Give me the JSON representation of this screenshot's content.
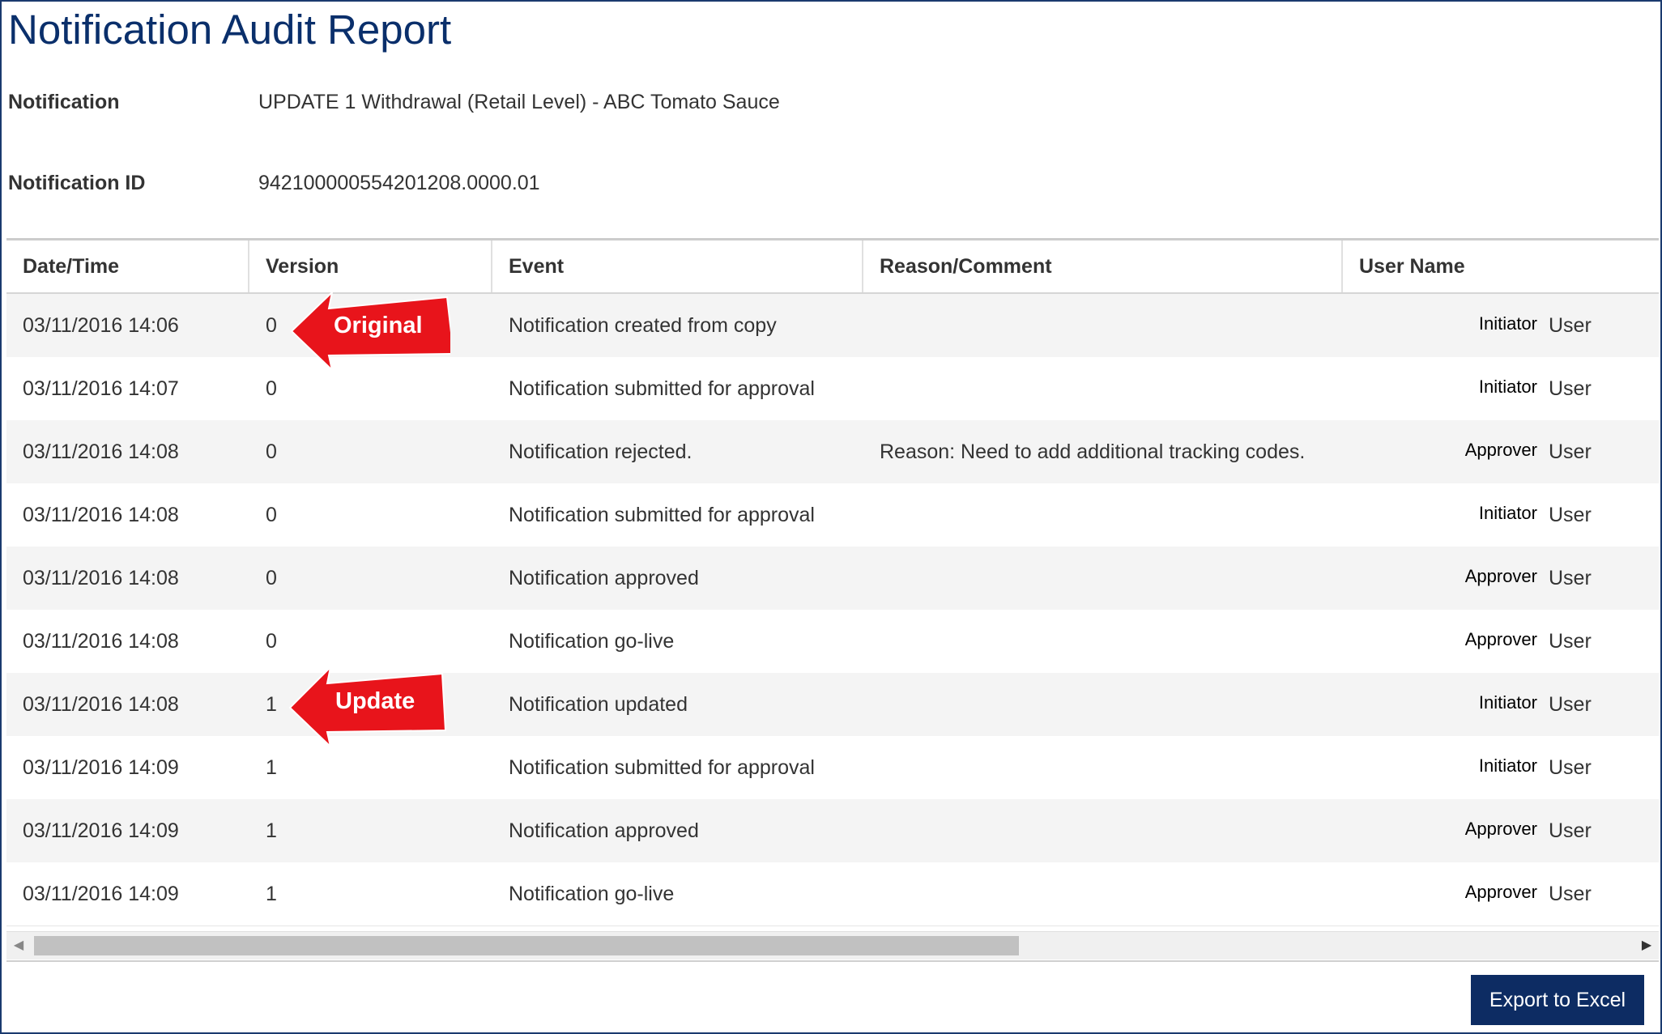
{
  "page": {
    "title": "Notification Audit Report",
    "notification_label": "Notification",
    "notification_value": "UPDATE 1 Withdrawal (Retail Level) - ABC Tomato Sauce",
    "notification_id_label": "Notification ID",
    "notification_id_value": "942100000554201208.0000.01"
  },
  "table": {
    "columns": [
      "Date/Time",
      "Version",
      "Event",
      "Reason/Comment",
      "User Name"
    ],
    "rows": [
      {
        "datetime": "03/11/2016 14:06",
        "version": "0",
        "event": "Notification created from copy",
        "reason": "",
        "role": "Initiator",
        "user": "User"
      },
      {
        "datetime": "03/11/2016 14:07",
        "version": "0",
        "event": "Notification submitted for approval",
        "reason": "",
        "role": "Initiator",
        "user": "User"
      },
      {
        "datetime": "03/11/2016 14:08",
        "version": "0",
        "event": "Notification rejected.",
        "reason": "Reason: Need to add additional tracking codes.",
        "role": "Approver",
        "user": "User"
      },
      {
        "datetime": "03/11/2016 14:08",
        "version": "0",
        "event": "Notification submitted for approval",
        "reason": "",
        "role": "Initiator",
        "user": "User"
      },
      {
        "datetime": "03/11/2016 14:08",
        "version": "0",
        "event": "Notification approved",
        "reason": "",
        "role": "Approver",
        "user": "User"
      },
      {
        "datetime": "03/11/2016 14:08",
        "version": "0",
        "event": "Notification go-live",
        "reason": "",
        "role": "Approver",
        "user": "User"
      },
      {
        "datetime": "03/11/2016 14:08",
        "version": "1",
        "event": "Notification updated",
        "reason": "",
        "role": "Initiator",
        "user": "User"
      },
      {
        "datetime": "03/11/2016 14:09",
        "version": "1",
        "event": "Notification submitted for approval",
        "reason": "",
        "role": "Initiator",
        "user": "User"
      },
      {
        "datetime": "03/11/2016 14:09",
        "version": "1",
        "event": "Notification approved",
        "reason": "",
        "role": "Approver",
        "user": "User"
      },
      {
        "datetime": "03/11/2016 14:09",
        "version": "1",
        "event": "Notification go-live",
        "reason": "",
        "role": "Approver",
        "user": "User"
      }
    ]
  },
  "callouts": {
    "original": "Original",
    "update": "Update",
    "color": "#e8141b"
  },
  "scrollbar": {
    "left_icon": "scroll-left-arrow-icon",
    "right_icon": "scroll-right-arrow-icon"
  },
  "footer": {
    "export_label": "Export to Excel"
  },
  "colors": {
    "title": "#0a2f6b",
    "button_bg": "#0d2c63",
    "row_alt": "#f4f4f4"
  }
}
